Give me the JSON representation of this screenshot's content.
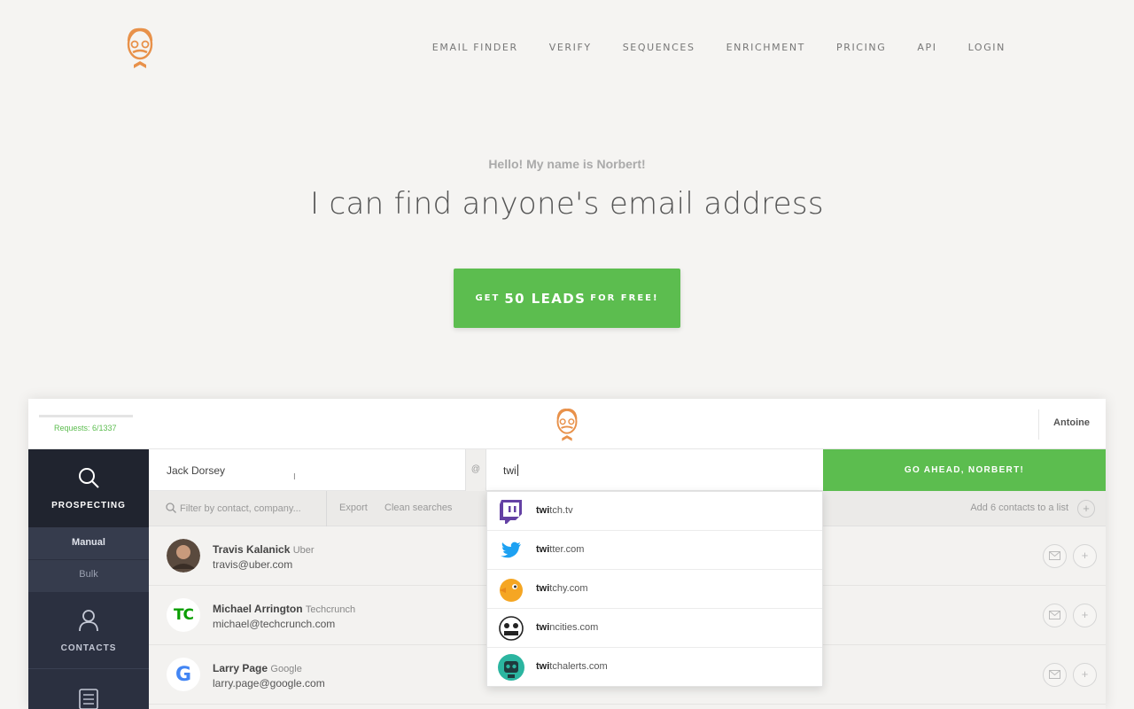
{
  "nav": {
    "items": [
      "EMAIL FINDER",
      "VERIFY",
      "SEQUENCES",
      "ENRICHMENT",
      "PRICING",
      "API",
      "LOGIN"
    ]
  },
  "hero": {
    "greeting": "Hello! My name is Norbert!",
    "headline": "I can find anyone's email address",
    "cta_prefix": "GET",
    "cta_main": "50 LEADS",
    "cta_suffix": "FOR FREE!"
  },
  "app": {
    "requests": "Requests: 6/1337",
    "user": "Antoine",
    "sidebar": {
      "prospecting": "PROSPECTING",
      "manual": "Manual",
      "bulk": "Bulk",
      "contacts": "CONTACTS"
    },
    "search": {
      "name_value": "Jack Dorsey",
      "at": "@",
      "domain_value": "twi",
      "go_label": "GO AHEAD, NORBERT!"
    },
    "toolbar": {
      "filter_placeholder": "Filter by contact, company...",
      "export": "Export",
      "clean": "Clean searches",
      "add_to_list": "Add 6 contacts to a list",
      "plus": "+"
    },
    "contacts": [
      {
        "name": "Travis Kalanick",
        "company": "Uber",
        "email": "travis@uber.com"
      },
      {
        "name": "Michael Arrington",
        "company": "Techcrunch",
        "email": "michael@techcrunch.com"
      },
      {
        "name": "Larry Page",
        "company": "Google",
        "email": "larry.page@google.com"
      }
    ],
    "suggestions": [
      {
        "match": "twi",
        "rest": "tch.tv",
        "icon": "twitch-logo-icon",
        "color": "#6441a4"
      },
      {
        "match": "twi",
        "rest": "tter.com",
        "icon": "twitter-bird-icon",
        "color": "#1da1f2"
      },
      {
        "match": "twi",
        "rest": "tchy.com",
        "icon": "twitchy-bird-icon",
        "color": "#f5a623"
      },
      {
        "match": "twi",
        "rest": "ncities.com",
        "icon": "twincities-logo-icon",
        "color": "#222222"
      },
      {
        "match": "twi",
        "rest": "tchalerts.com",
        "icon": "twitchalerts-robot-icon",
        "color": "#2bb5a0"
      }
    ],
    "tc_logo": "TC",
    "google_logo": "G"
  }
}
